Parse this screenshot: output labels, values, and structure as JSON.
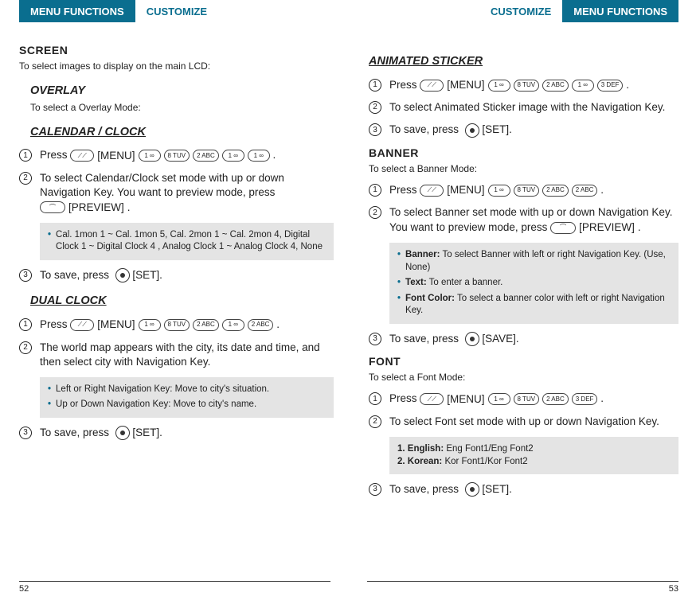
{
  "tabs": {
    "menu_functions": "MENU FUNCTIONS",
    "customize": "CUSTOMIZE"
  },
  "labels": {
    "menu": "[MENU]",
    "preview": "[PREVIEW]",
    "set": "[SET].",
    "save": "[SAVE]."
  },
  "left": {
    "screen": {
      "title": "SCREEN",
      "sub": "To select images to display on the main LCD:"
    },
    "overlay": {
      "title": "OVERLAY",
      "sub": "To select a Overlay Mode:"
    },
    "calendar": {
      "title": "CALENDAR / CLOCK",
      "step1_a": "Press",
      "step1_b": ".",
      "step2": "To select Calendar/Clock set mode with up or down Navigation Key. You want to preview mode, press",
      "note1": "Cal. 1mon 1 ~ Cal. 1mon 5, Cal. 2mon 1 ~ Cal. 2mon 4, Digital Clock 1 ~ Digital Clock 4 , Analog Clock 1 ~ Analog Clock 4, None",
      "step3": "To save, press"
    },
    "dual": {
      "title": "DUAL CLOCK",
      "step1_a": "Press",
      "step1_b": ".",
      "step2": "The world map appears with the city, its date and time, and then select city with Navigation Key.",
      "note_a": "Left or Right Navigation Key: Move to city's situation.",
      "note_b": "Up or Down Navigation Key: Move to city's name.",
      "step3": "To save, press"
    },
    "page_no": "52"
  },
  "right": {
    "animated": {
      "title": "ANIMATED STICKER",
      "step1_a": "Press",
      "step1_b": ".",
      "step2": "To select Animated Sticker image with the Navigation Key.",
      "step3": "To save, press"
    },
    "banner": {
      "title": "BANNER",
      "sub": "To select a Banner Mode:",
      "step1_a": "Press",
      "step1_b": ".",
      "step2_a": "To select Banner set mode with up or down Navigation Key. You want to preview mode, press",
      "note_banner_k": "Banner:",
      "note_banner_v": " To select Banner with left or right Navigation Key. (Use, None)",
      "note_text_k": "Text:",
      "note_text_v": " To enter a banner.",
      "note_font_k": "Font Color:",
      "note_font_v": " To select a banner color with left or right Navigation Key.",
      "step3": "To save, press"
    },
    "font": {
      "title": "FONT",
      "sub": "To select a Font Mode:",
      "step1_a": "Press",
      "step1_b": ".",
      "step2": "To select Font set mode with up or down Navigation Key.",
      "n1k": "1. English:",
      "n1v": " Eng Font1/Eng Font2",
      "n2k": "2. Korean:",
      "n2v": " Kor Font1/Kor Font2",
      "step3": "To save, press"
    },
    "page_no": "53"
  },
  "keys": {
    "k1": "1 ∞",
    "k8": "8 TUV",
    "k2": "2 ABC",
    "k3": "3 DEF",
    "menu_glyph": "⟋⟋",
    "long_glyph": "⌒"
  }
}
